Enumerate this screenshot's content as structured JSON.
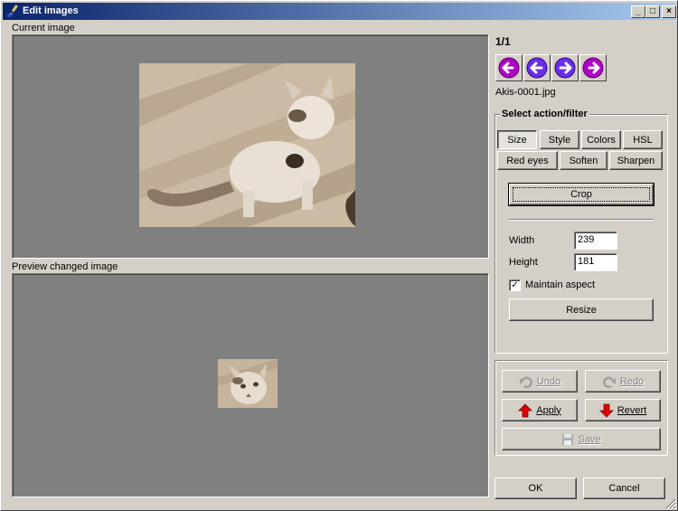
{
  "window": {
    "title": "Edit images",
    "controls": {
      "minimize": "_",
      "maximize": "□",
      "close": "×"
    }
  },
  "current_image": {
    "label": "Current image"
  },
  "preview_image": {
    "label": "Preview changed image"
  },
  "navigator": {
    "counter": "1/1",
    "filename": "Akis-0001.jpg",
    "buttons": [
      "first-icon",
      "previous-icon",
      "next-icon",
      "last-icon"
    ],
    "accent": "#b000c8"
  },
  "actions": {
    "group_title": "Select action/filter",
    "tabs_row1": [
      "Size",
      "Style",
      "Colors",
      "HSL"
    ],
    "tabs_row2": [
      "Red eyes",
      "Soften",
      "Sharpen"
    ],
    "crop_label": "Crop",
    "width_label": "Width",
    "width_value": "239",
    "height_label": "Height",
    "height_value": "181",
    "maintain_aspect_label": "Maintain aspect",
    "maintain_aspect_checked": true,
    "resize_label": "Resize"
  },
  "edit": {
    "undo_label": "Undo",
    "redo_label": "Redo",
    "apply_label": "Apply",
    "revert_label": "Revert",
    "save_label": "Save"
  },
  "footer": {
    "ok_label": "OK",
    "cancel_label": "Cancel"
  },
  "colors": {
    "canvas_bg": "#808080",
    "face": "#d4d0c8",
    "title_start": "#0a246a",
    "title_end": "#a6caf0"
  }
}
